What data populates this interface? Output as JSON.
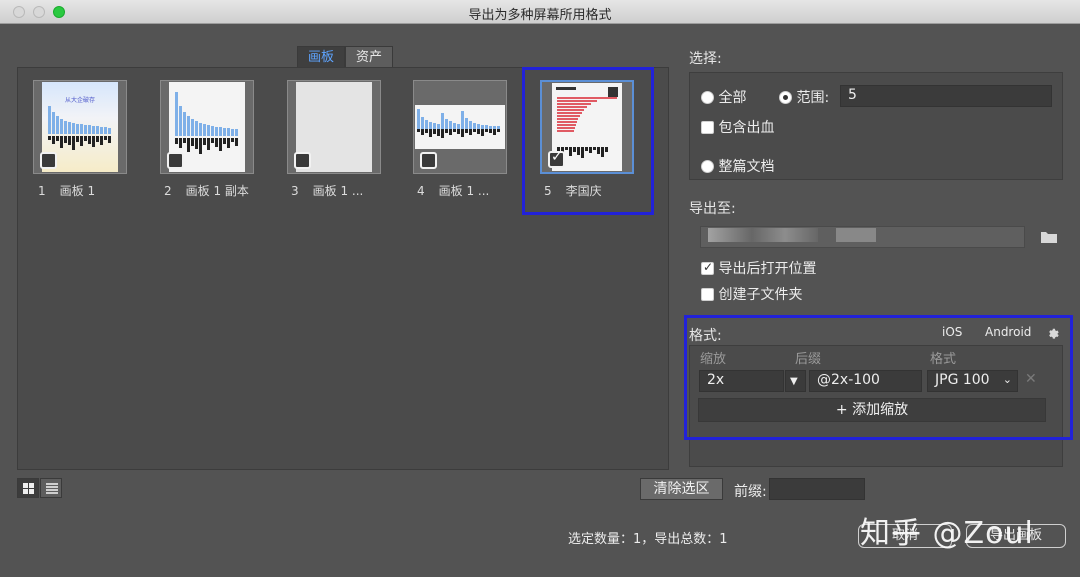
{
  "window": {
    "title": "导出为多种屏幕所用格式"
  },
  "tabs": [
    {
      "label": "画板"
    },
    {
      "label": "资产"
    }
  ],
  "artboards": [
    {
      "num": "1",
      "name": "画板 1",
      "checked": false
    },
    {
      "num": "2",
      "name": "画板 1 副本",
      "checked": false
    },
    {
      "num": "3",
      "name": "画板 1 ...",
      "checked": false
    },
    {
      "num": "4",
      "name": "画板 1 ...",
      "checked": false
    },
    {
      "num": "5",
      "name": "李国庆",
      "checked": true
    }
  ],
  "thumb1_text": "从大企破存",
  "select": {
    "label": "选择:",
    "all": "全部",
    "range": "范围:",
    "range_value": "5",
    "bleed": "包含出血",
    "whole_doc": "整篇文档"
  },
  "export_to": {
    "label": "导出至:",
    "open_after": "导出后打开位置",
    "create_subfolder": "创建子文件夹"
  },
  "format": {
    "label": "格式:",
    "ios": "iOS",
    "android": "Android",
    "col_scale": "缩放",
    "col_suffix": "后缀",
    "col_format": "格式",
    "scale_value": "2x",
    "suffix_value": "@2x-100",
    "format_value": "JPG 100",
    "add_scale": "添加缩放"
  },
  "bottom": {
    "clear_selection": "清除选区",
    "prefix_label": "前缀:",
    "status": "选定数量：1，导出总数：1",
    "watermark": "知乎 @Zoul",
    "cancel": "取消",
    "export": "导出画板"
  },
  "colors": {
    "highlight_border": "#2222d9",
    "tab_active_text": "#5ea4ff",
    "chart_blue": "#7fb0e8",
    "chart_red": "#e05a63"
  }
}
